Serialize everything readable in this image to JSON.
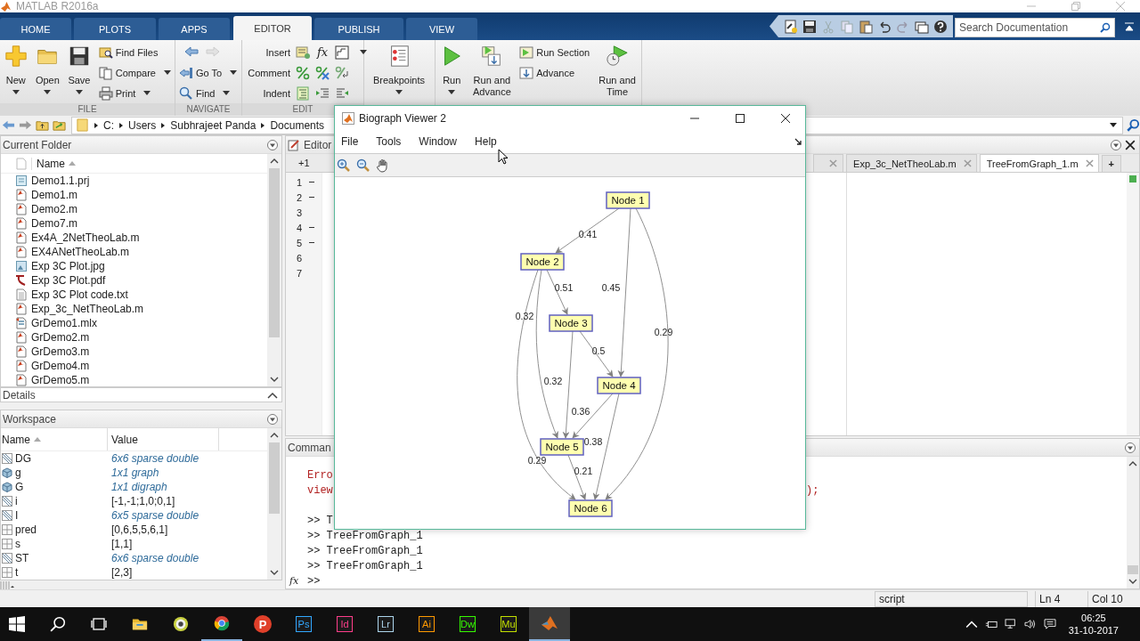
{
  "window": {
    "title": "MATLAB R2016a"
  },
  "tabs": [
    {
      "label": "HOME",
      "selected": false
    },
    {
      "label": "PLOTS",
      "selected": false
    },
    {
      "label": "APPS",
      "selected": false
    },
    {
      "label": "EDITOR",
      "selected": true
    },
    {
      "label": "PUBLISH",
      "selected": false
    },
    {
      "label": "VIEW",
      "selected": false
    }
  ],
  "search": {
    "placeholder": "Search Documentation"
  },
  "ribbon": {
    "file": {
      "label": "FILE",
      "new": "New",
      "open": "Open",
      "save": "Save",
      "find_files": "Find Files",
      "compare": "Compare",
      "print": "Print"
    },
    "navigate": {
      "label": "NAVIGATE",
      "go_to": "Go To",
      "find": "Find"
    },
    "edit": {
      "label": "EDIT",
      "insert": "Insert",
      "comment": "Comment",
      "indent": "Indent",
      "function_icon": "fx"
    },
    "run": {
      "breakpoints": "Breakpoints",
      "run": "Run",
      "run_and_advance": "Run and Advance",
      "run_section": "Run Section",
      "advance": "Advance",
      "run_and_time": "Run and Time"
    }
  },
  "path": [
    "C:",
    "Users",
    "Subhrajeet Panda",
    "Documents"
  ],
  "current_folder": {
    "title": "Current Folder",
    "column": "Name",
    "files": [
      {
        "name": "Demo1.1.prj",
        "kind": "project"
      },
      {
        "name": "Demo1.m",
        "kind": "script"
      },
      {
        "name": "Demo2.m",
        "kind": "script"
      },
      {
        "name": "Demo7.m",
        "kind": "script"
      },
      {
        "name": "Ex4A_2NetTheoLab.m",
        "kind": "script"
      },
      {
        "name": "EX4ANetTheoLab.m",
        "kind": "script"
      },
      {
        "name": "Exp 3C Plot.jpg",
        "kind": "image"
      },
      {
        "name": "Exp 3C Plot.pdf",
        "kind": "pdf"
      },
      {
        "name": "Exp 3C Plot code.txt",
        "kind": "text"
      },
      {
        "name": "Exp_3c_NetTheoLab.m",
        "kind": "script"
      },
      {
        "name": "GrDemo1.mlx",
        "kind": "live"
      },
      {
        "name": "GrDemo2.m",
        "kind": "script"
      },
      {
        "name": "GrDemo3.m",
        "kind": "script"
      },
      {
        "name": "GrDemo4.m",
        "kind": "script"
      },
      {
        "name": "GrDemo5.m",
        "kind": "script"
      }
    ]
  },
  "details": {
    "title": "Details"
  },
  "workspace": {
    "title": "Workspace",
    "columns": [
      "Name",
      "Value"
    ],
    "variables": [
      {
        "name": "DG",
        "value": "6x6 sparse double",
        "kind": "sparse",
        "summary": true
      },
      {
        "name": "g",
        "value": "1x1 graph",
        "kind": "object",
        "summary": true
      },
      {
        "name": "G",
        "value": "1x1 digraph",
        "kind": "object",
        "summary": true
      },
      {
        "name": "i",
        "value": "[-1,-1;1,0;0,1]",
        "kind": "sparse",
        "summary": false
      },
      {
        "name": "I",
        "value": "6x5 sparse double",
        "kind": "sparse",
        "summary": true
      },
      {
        "name": "pred",
        "value": "[0,6,5,5,6,1]",
        "kind": "matrix",
        "summary": false
      },
      {
        "name": "s",
        "value": "[1,1]",
        "kind": "matrix",
        "summary": false
      },
      {
        "name": "ST",
        "value": "6x6 sparse double",
        "kind": "sparse",
        "summary": true
      },
      {
        "name": "t",
        "value": "[2,3]",
        "kind": "matrix",
        "summary": false
      }
    ]
  },
  "editor": {
    "title": "Editor",
    "change_count": "+1",
    "tabs": [
      {
        "label": "Exp_3c_NetTheoLab.m",
        "selected": false
      },
      {
        "label": "TreeFromGraph_1.m",
        "selected": true
      }
    ],
    "new_tab": "+",
    "lines": [
      {
        "number": "1",
        "marker": true
      },
      {
        "number": "2",
        "marker": true
      },
      {
        "number": "3",
        "marker": false
      },
      {
        "number": "4",
        "marker": true
      },
      {
        "number": "5",
        "marker": true
      },
      {
        "number": "6",
        "marker": false
      },
      {
        "number": "7",
        "marker": false
      }
    ]
  },
  "command_window": {
    "title": "Comman",
    "lines": [
      {
        "kind": "error",
        "text": "Erro"
      },
      {
        "kind": "error",
        "text": "view",
        "tail": ");"
      },
      {
        "kind": "command",
        "text": ">> T"
      },
      {
        "kind": "command",
        "text": ">> TreeFromGraph_1"
      },
      {
        "kind": "command",
        "text": ">> TreeFromGraph_1"
      },
      {
        "kind": "command",
        "text": ">> TreeFromGraph_1"
      }
    ],
    "function_icon": "fx",
    "prompt": ">>"
  },
  "status_bar": {
    "mode": "script",
    "line": "Ln 4",
    "column": "Col 10"
  },
  "biograph": {
    "title": "Biograph Viewer 2",
    "menu": [
      "File",
      "Tools",
      "Window",
      "Help"
    ],
    "nodes": [
      {
        "label": "Node 1"
      },
      {
        "label": "Node 2"
      },
      {
        "label": "Node 3"
      },
      {
        "label": "Node 4"
      },
      {
        "label": "Node 5"
      },
      {
        "label": "Node 6"
      }
    ],
    "edges": [
      {
        "label": "0.41"
      },
      {
        "label": "0.45"
      },
      {
        "label": "0.29"
      },
      {
        "label": "0.51"
      },
      {
        "label": "0.32"
      },
      {
        "label": "0.32"
      },
      {
        "label": "0.5"
      },
      {
        "label": "0.36"
      },
      {
        "label": "0.38"
      },
      {
        "label": "0.21"
      },
      {
        "label": "0.29"
      }
    ]
  },
  "taskbar": {
    "apps": [
      {
        "kind": "explorer",
        "running": false
      },
      {
        "kind": "disc",
        "running": false
      },
      {
        "kind": "chrome",
        "running": true
      },
      {
        "kind": "badge",
        "label": "P",
        "running": false
      },
      {
        "kind": "adobe",
        "label": "Ps",
        "color": "#31a8ff",
        "running": false
      },
      {
        "kind": "adobe",
        "label": "Id",
        "color": "#ff3d8b",
        "running": false
      },
      {
        "kind": "adobe",
        "label": "Lr",
        "color": "#add5ec",
        "running": false
      },
      {
        "kind": "adobe",
        "label": "Ai",
        "color": "#ff9a00",
        "running": false
      },
      {
        "kind": "adobe",
        "label": "Dw",
        "color": "#35fa00",
        "running": false
      },
      {
        "kind": "adobe",
        "label": "Mu",
        "color": "#c2e000",
        "running": false
      },
      {
        "kind": "matlab",
        "running": true
      }
    ],
    "time": "06:25",
    "date": "31-10-2017"
  }
}
